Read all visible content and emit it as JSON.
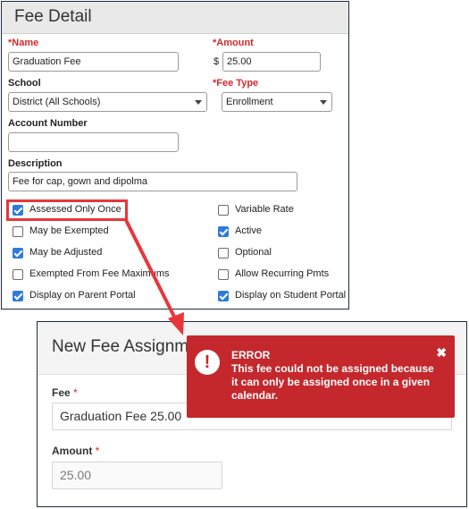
{
  "fee_detail": {
    "title": "Fee Detail",
    "name": {
      "required": "*",
      "label": "Name",
      "value": "Graduation Fee"
    },
    "amount": {
      "required": "*",
      "label": "Amount",
      "currency": "$",
      "value": "25.00"
    },
    "school": {
      "label": "School",
      "value": "District (All Schools)"
    },
    "fee_type": {
      "required": "*",
      "label": "Fee Type",
      "value": "Enrollment"
    },
    "account_number": {
      "label": "Account Number",
      "value": ""
    },
    "description": {
      "label": "Description",
      "value": "Fee for cap, gown and dipolma"
    },
    "checkboxes_left": [
      {
        "label": "Assessed Only Once",
        "checked": true
      },
      {
        "label": "May be Exempted",
        "checked": false
      },
      {
        "label": "May be Adjusted",
        "checked": true
      },
      {
        "label": "Exempted From Fee Maximums",
        "checked": false
      },
      {
        "label": "Display on Parent Portal",
        "checked": true
      }
    ],
    "checkboxes_right": [
      {
        "label": "Variable Rate",
        "checked": false
      },
      {
        "label": "Active",
        "checked": true
      },
      {
        "label": "Optional",
        "checked": false
      },
      {
        "label": "Allow Recurring Pmts",
        "checked": false
      },
      {
        "label": "Display on Student Portal",
        "checked": true
      }
    ]
  },
  "new_fee_assignment": {
    "title": "New Fee Assignm",
    "fee": {
      "label": "Fee",
      "required": "*",
      "value": "Graduation Fee 25.00"
    },
    "amount": {
      "label": "Amount",
      "required": "*",
      "value": "25.00"
    }
  },
  "error": {
    "icon": "exclamation-icon",
    "title": "ERROR",
    "message": "This fee could not be assigned because it can only be assigned once in a given calendar.",
    "close": "✖"
  },
  "colors": {
    "accent": "#2f7bd9",
    "error_bg": "#c4282d",
    "highlight": "#e8363b",
    "required": "#d42b2b"
  }
}
